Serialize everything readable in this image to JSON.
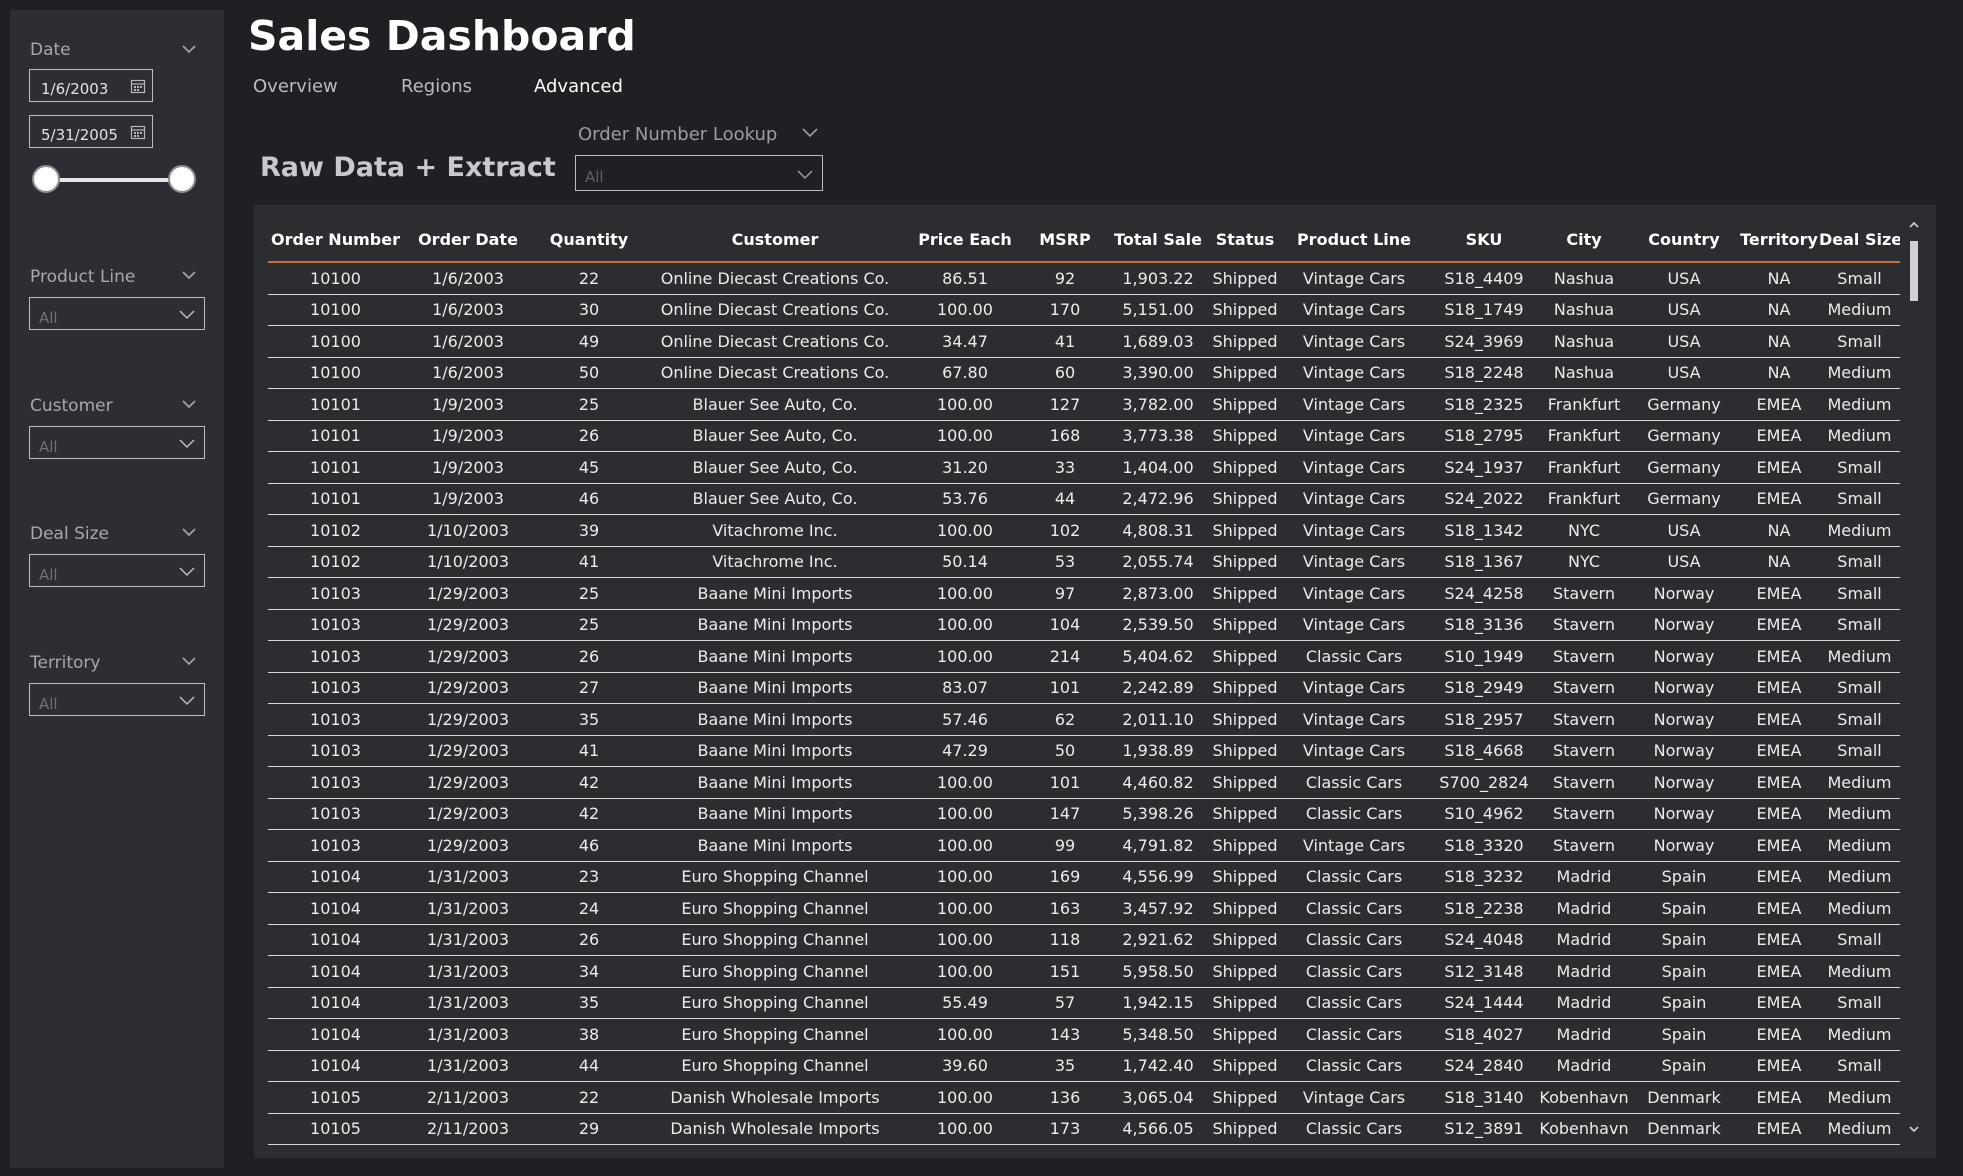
{
  "header": {
    "title": "Sales Dashboard"
  },
  "tabs": [
    {
      "label": "Overview"
    },
    {
      "label": "Regions"
    },
    {
      "label": "Advanced"
    }
  ],
  "active_tab": "Advanced",
  "filters": {
    "date": {
      "label": "Date",
      "start": "1/6/2003",
      "end": "5/31/2005",
      "range_selected": [
        0,
        1
      ]
    },
    "product_line": {
      "label": "Product Line",
      "value": "All"
    },
    "customer": {
      "label": "Customer",
      "value": "All"
    },
    "deal_size": {
      "label": "Deal Size",
      "value": "All"
    },
    "territory": {
      "label": "Territory",
      "value": "All"
    }
  },
  "section": {
    "title": "Raw Data + Extract"
  },
  "lookup": {
    "label": "Order Number Lookup",
    "value": "All"
  },
  "table": {
    "columns": [
      "Order Number",
      "Order Date",
      "Quantity",
      "Customer",
      "Price Each",
      "MSRP",
      "Total Sale",
      "Status",
      "Product Line",
      "SKU",
      "City",
      "Country",
      "Territory",
      "Deal Size"
    ],
    "rows": [
      [
        "10100",
        "1/6/2003",
        "22",
        "Online Diecast Creations Co.",
        "86.51",
        "92",
        "1,903.22",
        "Shipped",
        "Vintage Cars",
        "S18_4409",
        "Nashua",
        "USA",
        "NA",
        "Small"
      ],
      [
        "10100",
        "1/6/2003",
        "30",
        "Online Diecast Creations Co.",
        "100.00",
        "170",
        "5,151.00",
        "Shipped",
        "Vintage Cars",
        "S18_1749",
        "Nashua",
        "USA",
        "NA",
        "Medium"
      ],
      [
        "10100",
        "1/6/2003",
        "49",
        "Online Diecast Creations Co.",
        "34.47",
        "41",
        "1,689.03",
        "Shipped",
        "Vintage Cars",
        "S24_3969",
        "Nashua",
        "USA",
        "NA",
        "Small"
      ],
      [
        "10100",
        "1/6/2003",
        "50",
        "Online Diecast Creations Co.",
        "67.80",
        "60",
        "3,390.00",
        "Shipped",
        "Vintage Cars",
        "S18_2248",
        "Nashua",
        "USA",
        "NA",
        "Medium"
      ],
      [
        "10101",
        "1/9/2003",
        "25",
        "Blauer See Auto, Co.",
        "100.00",
        "127",
        "3,782.00",
        "Shipped",
        "Vintage Cars",
        "S18_2325",
        "Frankfurt",
        "Germany",
        "EMEA",
        "Medium"
      ],
      [
        "10101",
        "1/9/2003",
        "26",
        "Blauer See Auto, Co.",
        "100.00",
        "168",
        "3,773.38",
        "Shipped",
        "Vintage Cars",
        "S18_2795",
        "Frankfurt",
        "Germany",
        "EMEA",
        "Medium"
      ],
      [
        "10101",
        "1/9/2003",
        "45",
        "Blauer See Auto, Co.",
        "31.20",
        "33",
        "1,404.00",
        "Shipped",
        "Vintage Cars",
        "S24_1937",
        "Frankfurt",
        "Germany",
        "EMEA",
        "Small"
      ],
      [
        "10101",
        "1/9/2003",
        "46",
        "Blauer See Auto, Co.",
        "53.76",
        "44",
        "2,472.96",
        "Shipped",
        "Vintage Cars",
        "S24_2022",
        "Frankfurt",
        "Germany",
        "EMEA",
        "Small"
      ],
      [
        "10102",
        "1/10/2003",
        "39",
        "Vitachrome Inc.",
        "100.00",
        "102",
        "4,808.31",
        "Shipped",
        "Vintage Cars",
        "S18_1342",
        "NYC",
        "USA",
        "NA",
        "Medium"
      ],
      [
        "10102",
        "1/10/2003",
        "41",
        "Vitachrome Inc.",
        "50.14",
        "53",
        "2,055.74",
        "Shipped",
        "Vintage Cars",
        "S18_1367",
        "NYC",
        "USA",
        "NA",
        "Small"
      ],
      [
        "10103",
        "1/29/2003",
        "25",
        "Baane Mini Imports",
        "100.00",
        "97",
        "2,873.00",
        "Shipped",
        "Vintage Cars",
        "S24_4258",
        "Stavern",
        "Norway",
        "EMEA",
        "Small"
      ],
      [
        "10103",
        "1/29/2003",
        "25",
        "Baane Mini Imports",
        "100.00",
        "104",
        "2,539.50",
        "Shipped",
        "Vintage Cars",
        "S18_3136",
        "Stavern",
        "Norway",
        "EMEA",
        "Small"
      ],
      [
        "10103",
        "1/29/2003",
        "26",
        "Baane Mini Imports",
        "100.00",
        "214",
        "5,404.62",
        "Shipped",
        "Classic Cars",
        "S10_1949",
        "Stavern",
        "Norway",
        "EMEA",
        "Medium"
      ],
      [
        "10103",
        "1/29/2003",
        "27",
        "Baane Mini Imports",
        "83.07",
        "101",
        "2,242.89",
        "Shipped",
        "Vintage Cars",
        "S18_2949",
        "Stavern",
        "Norway",
        "EMEA",
        "Small"
      ],
      [
        "10103",
        "1/29/2003",
        "35",
        "Baane Mini Imports",
        "57.46",
        "62",
        "2,011.10",
        "Shipped",
        "Vintage Cars",
        "S18_2957",
        "Stavern",
        "Norway",
        "EMEA",
        "Small"
      ],
      [
        "10103",
        "1/29/2003",
        "41",
        "Baane Mini Imports",
        "47.29",
        "50",
        "1,938.89",
        "Shipped",
        "Vintage Cars",
        "S18_4668",
        "Stavern",
        "Norway",
        "EMEA",
        "Small"
      ],
      [
        "10103",
        "1/29/2003",
        "42",
        "Baane Mini Imports",
        "100.00",
        "101",
        "4,460.82",
        "Shipped",
        "Classic Cars",
        "S700_2824",
        "Stavern",
        "Norway",
        "EMEA",
        "Medium"
      ],
      [
        "10103",
        "1/29/2003",
        "42",
        "Baane Mini Imports",
        "100.00",
        "147",
        "5,398.26",
        "Shipped",
        "Classic Cars",
        "S10_4962",
        "Stavern",
        "Norway",
        "EMEA",
        "Medium"
      ],
      [
        "10103",
        "1/29/2003",
        "46",
        "Baane Mini Imports",
        "100.00",
        "99",
        "4,791.82",
        "Shipped",
        "Vintage Cars",
        "S18_3320",
        "Stavern",
        "Norway",
        "EMEA",
        "Medium"
      ],
      [
        "10104",
        "1/31/2003",
        "23",
        "Euro Shopping Channel",
        "100.00",
        "169",
        "4,556.99",
        "Shipped",
        "Classic Cars",
        "S18_3232",
        "Madrid",
        "Spain",
        "EMEA",
        "Medium"
      ],
      [
        "10104",
        "1/31/2003",
        "24",
        "Euro Shopping Channel",
        "100.00",
        "163",
        "3,457.92",
        "Shipped",
        "Classic Cars",
        "S18_2238",
        "Madrid",
        "Spain",
        "EMEA",
        "Medium"
      ],
      [
        "10104",
        "1/31/2003",
        "26",
        "Euro Shopping Channel",
        "100.00",
        "118",
        "2,921.62",
        "Shipped",
        "Classic Cars",
        "S24_4048",
        "Madrid",
        "Spain",
        "EMEA",
        "Small"
      ],
      [
        "10104",
        "1/31/2003",
        "34",
        "Euro Shopping Channel",
        "100.00",
        "151",
        "5,958.50",
        "Shipped",
        "Classic Cars",
        "S12_3148",
        "Madrid",
        "Spain",
        "EMEA",
        "Medium"
      ],
      [
        "10104",
        "1/31/2003",
        "35",
        "Euro Shopping Channel",
        "55.49",
        "57",
        "1,942.15",
        "Shipped",
        "Classic Cars",
        "S24_1444",
        "Madrid",
        "Spain",
        "EMEA",
        "Small"
      ],
      [
        "10104",
        "1/31/2003",
        "38",
        "Euro Shopping Channel",
        "100.00",
        "143",
        "5,348.50",
        "Shipped",
        "Classic Cars",
        "S18_4027",
        "Madrid",
        "Spain",
        "EMEA",
        "Medium"
      ],
      [
        "10104",
        "1/31/2003",
        "44",
        "Euro Shopping Channel",
        "39.60",
        "35",
        "1,742.40",
        "Shipped",
        "Classic Cars",
        "S24_2840",
        "Madrid",
        "Spain",
        "EMEA",
        "Small"
      ],
      [
        "10105",
        "2/11/2003",
        "22",
        "Danish Wholesale Imports",
        "100.00",
        "136",
        "3,065.04",
        "Shipped",
        "Vintage Cars",
        "S18_3140",
        "Kobenhavn",
        "Denmark",
        "EMEA",
        "Medium"
      ],
      [
        "10105",
        "2/11/2003",
        "29",
        "Danish Wholesale Imports",
        "100.00",
        "173",
        "4,566.05",
        "Shipped",
        "Classic Cars",
        "S12_3891",
        "Kobenhavn",
        "Denmark",
        "EMEA",
        "Medium"
      ]
    ]
  },
  "colors": {
    "background": "#1f2024",
    "panel": "#2c2e33",
    "header_rule": "#c8703a"
  },
  "icons": [
    "chevron-down-icon",
    "calendar-icon",
    "scroll-up-icon",
    "scroll-down-icon"
  ]
}
